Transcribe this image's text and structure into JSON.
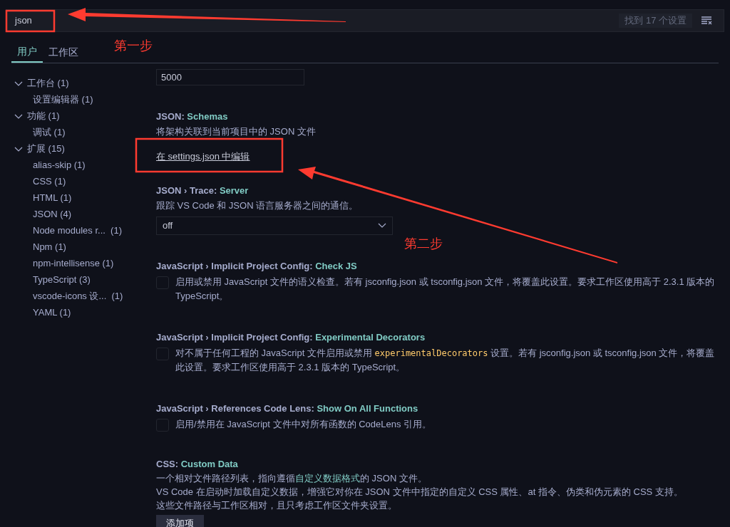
{
  "search": {
    "value": "json",
    "result_count": "找到 17 个设置"
  },
  "tabs": [
    {
      "label": "用户",
      "selected": true
    },
    {
      "label": "工作区",
      "selected": false
    }
  ],
  "sidebar": {
    "items": [
      {
        "label": "工作台 (1)",
        "expanded": true,
        "children": [
          {
            "label": "设置编辑器 (1)"
          }
        ]
      },
      {
        "label": "功能 (1)",
        "expanded": true,
        "children": [
          {
            "label": "调试 (1)"
          }
        ]
      },
      {
        "label": "扩展 (15)",
        "expanded": true,
        "children": [
          {
            "label": "alias-skip (1)"
          },
          {
            "label": "CSS (1)"
          },
          {
            "label": "HTML (1)"
          },
          {
            "label": "JSON (4)"
          },
          {
            "label": "Node modules r...  (1)"
          },
          {
            "label": "Npm (1)"
          },
          {
            "label": "npm-intellisense (1)"
          },
          {
            "label": "TypeScript (3)"
          },
          {
            "label": "vscode-icons 设...  (1)"
          },
          {
            "label": "YAML (1)"
          }
        ]
      }
    ]
  },
  "settings": [
    {
      "kind": "input",
      "value": "5000"
    },
    {
      "kind": "link",
      "category": "JSON: ",
      "name": "Schemas",
      "description": [
        [
          {
            "kind": "plain",
            "text": "将架构关联到当前项目中的 JSON 文件"
          }
        ]
      ],
      "link": "在 settings.json 中编辑"
    },
    {
      "kind": "select",
      "category": "JSON › Trace: ",
      "name": "Server",
      "description": [
        [
          {
            "kind": "plain",
            "text": "跟踪 VS Code 和 JSON 语言服务器之间的通信。"
          }
        ]
      ],
      "value": "off"
    },
    {
      "kind": "checkbox",
      "category": "JavaScript › Implicit Project Config: ",
      "name": "Check JS",
      "checked": false,
      "description": [
        [
          {
            "kind": "plain",
            "text": "启用或禁用 JavaScript 文件的语义检查。若有 jsconfig.json 或 tsconfig.json 文件，将覆盖此设置。要求工作区使用高于 2.3.1 版本的 TypeScript。"
          }
        ]
      ]
    },
    {
      "kind": "checkbox",
      "category": "JavaScript › Implicit Project Config: ",
      "name": "Experimental Decorators",
      "checked": false,
      "description": [
        [
          {
            "kind": "plain",
            "text": "对不属于任何工程的 JavaScript 文件启用或禁用 "
          },
          {
            "kind": "code",
            "text": "experimentalDecorators"
          },
          {
            "kind": "plain",
            "text": " 设置。若有 jsconfig.json 或 tsconfig.json 文件，将覆盖此设置。要求工作区使用高于 2.3.1 版本的 TypeScript。"
          }
        ]
      ]
    },
    {
      "kind": "checkbox",
      "category": "JavaScript › References Code Lens: ",
      "name": "Show On All Functions",
      "checked": false,
      "description": [
        [
          {
            "kind": "plain",
            "text": "启用/禁用在 JavaScript 文件中对所有函数的 CodeLens 引用。"
          }
        ]
      ]
    },
    {
      "kind": "list",
      "category": "CSS: ",
      "name": "Custom Data",
      "description": [
        [
          {
            "kind": "plain",
            "text": "一个相对文件路径列表，指向遵循"
          },
          {
            "kind": "link",
            "text": "自定义数据格式"
          },
          {
            "kind": "plain",
            "text": "的 JSON 文件。"
          }
        ],
        [
          {
            "kind": "plain",
            "text": "VS Code 在启动时加载自定义数据，增强它对你在 JSON 文件中指定的自定义 CSS 属性、at 指令、伪类和伪元素的 CSS 支持。"
          }
        ],
        [
          {
            "kind": "plain",
            "text": "这些文件路径与工作区相对，且只考虑工作区文件夹设置。"
          }
        ]
      ],
      "button": "添加项"
    }
  ],
  "annotations": [
    {
      "kind": "label",
      "text": "第一步"
    },
    {
      "kind": "label",
      "text": "第二步"
    }
  ]
}
